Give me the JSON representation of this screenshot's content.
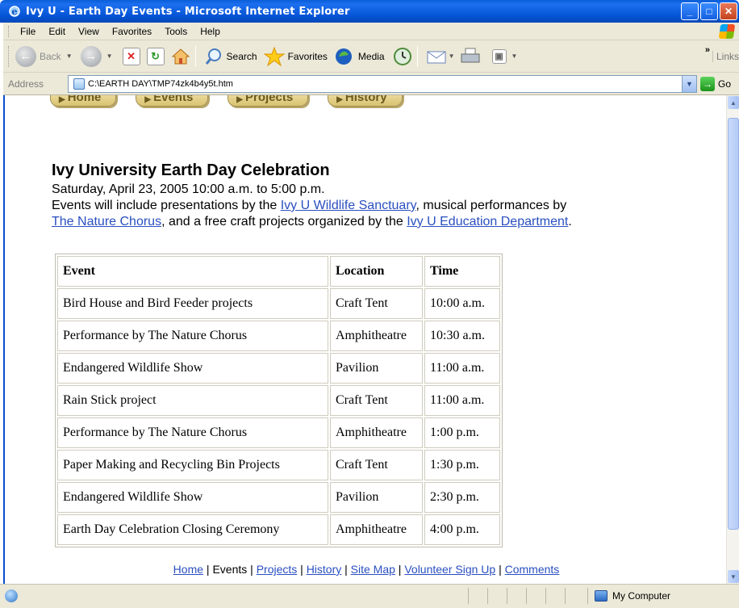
{
  "window": {
    "title": "Ivy U - Earth Day Events - Microsoft Internet Explorer"
  },
  "menubar": {
    "items": [
      "File",
      "Edit",
      "View",
      "Favorites",
      "Tools",
      "Help"
    ]
  },
  "toolbar": {
    "back_label": "Back",
    "search_label": "Search",
    "favorites_label": "Favorites",
    "media_label": "Media",
    "links_label": "Links"
  },
  "address": {
    "label": "Address",
    "url": "C:\\EARTH DAY\\TMP74zk4b4y5t.htm",
    "go_label": "Go"
  },
  "nav_tabs": [
    "Home",
    "Events",
    "Projects",
    "History"
  ],
  "page": {
    "heading": "Ivy University Earth Day Celebration",
    "date_line": "Saturday, April 23, 2005 10:00 a.m. to 5:00 p.m.",
    "intro_1": "Events will include presentations by the ",
    "link_sanctuary": "Ivy U Wildlife Sanctuary",
    "intro_2": ", musical performances by ",
    "link_chorus": "The Nature Chorus",
    "intro_3": ", and a free craft projects organized by the ",
    "link_education": "Ivy U Education Department",
    "intro_4": "."
  },
  "events_table": {
    "headers": [
      "Event",
      "Location",
      "Time"
    ],
    "rows": [
      [
        "Bird House and Bird Feeder projects",
        "Craft Tent",
        "10:00 a.m."
      ],
      [
        "Performance by The Nature Chorus",
        "Amphitheatre",
        "10:30 a.m."
      ],
      [
        "Endangered Wildlife Show",
        "Pavilion",
        "11:00 a.m."
      ],
      [
        "Rain Stick project",
        "Craft Tent",
        "11:00 a.m."
      ],
      [
        "Performance by The Nature Chorus",
        "Amphitheatre",
        "1:00 p.m."
      ],
      [
        "Paper Making and Recycling Bin Projects",
        "Craft Tent",
        "1:30 p.m."
      ],
      [
        "Endangered Wildlife Show",
        "Pavilion",
        "2:30 p.m."
      ],
      [
        "Earth Day Celebration Closing Ceremony",
        "Amphitheatre",
        "4:00 p.m."
      ]
    ]
  },
  "footer_nav": {
    "home": "Home",
    "events": "Events",
    "projects": "Projects",
    "history": "History",
    "site_map": "Site Map",
    "volunteer": "Volunteer Sign Up",
    "comments": "Comments",
    "separator": " | "
  },
  "statusbar": {
    "zone": "My Computer"
  }
}
